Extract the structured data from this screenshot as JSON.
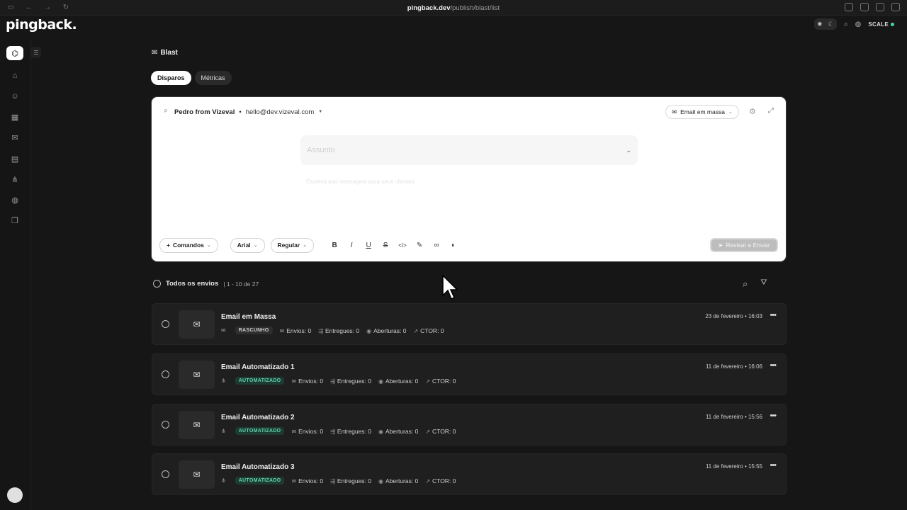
{
  "browser": {
    "host": "pingback.dev",
    "path": "/publish/blast/list"
  },
  "app": {
    "logo": "pingback.",
    "scale_label": "SCALE"
  },
  "page": {
    "title": "Blast",
    "tabs": [
      {
        "label": "Disparos",
        "active": true
      },
      {
        "label": "Métricas",
        "active": false
      }
    ]
  },
  "composer": {
    "sender_initial": "P",
    "sender_name": "Pedro from Vizeval",
    "sender_separator": "•",
    "sender_email": "hello@dev.vizeval.com",
    "type_label": "Email em massa",
    "subject_placeholder": "Assunto",
    "body_placeholder": "Escreva sua mensagem para seus clientes",
    "commands_label": "Comandos",
    "font_label": "Arial",
    "weight_label": "Regular",
    "submit_label": "Revisar e Enviar"
  },
  "list": {
    "title": "Todos os envios",
    "count": "| 1 - 10 de 27",
    "rows": [
      {
        "title": "Email em Massa",
        "status": "RASCUNHO",
        "status_kind": "draft",
        "envios": "Envios: 0",
        "entregues": "Entregues: 0",
        "aberturas": "Aberturas: 0",
        "ctor": "CTOR: 0",
        "date": "23 de fevereiro • 16:03"
      },
      {
        "title": "Email Automatizado 1",
        "status": "AUTOMATIZADO",
        "status_kind": "auto",
        "envios": "Envios: 0",
        "entregues": "Entregues: 0",
        "aberturas": "Aberturas: 0",
        "ctor": "CTOR: 0",
        "date": "11 de fevereiro • 16:06"
      },
      {
        "title": "Email Automatizado 2",
        "status": "AUTOMATIZADO",
        "status_kind": "auto",
        "envios": "Envios: 0",
        "entregues": "Entregues: 0",
        "aberturas": "Aberturas: 0",
        "ctor": "CTOR: 0",
        "date": "11 de fevereiro • 15:56"
      },
      {
        "title": "Email Automatizado 3",
        "status": "AUTOMATIZADO",
        "status_kind": "auto",
        "envios": "Envios: 0",
        "entregues": "Entregues: 0",
        "aberturas": "Aberturas: 0",
        "ctor": "CTOR: 0",
        "date": "11 de fevereiro • 15:55"
      }
    ]
  },
  "colors": {
    "background": "#161616",
    "row_background": "#1f1f1f",
    "automated_badge_text": "#5fd3ac",
    "automated_badge_bg": "#1e3b33",
    "scale_dot": "#3fd8a0"
  }
}
